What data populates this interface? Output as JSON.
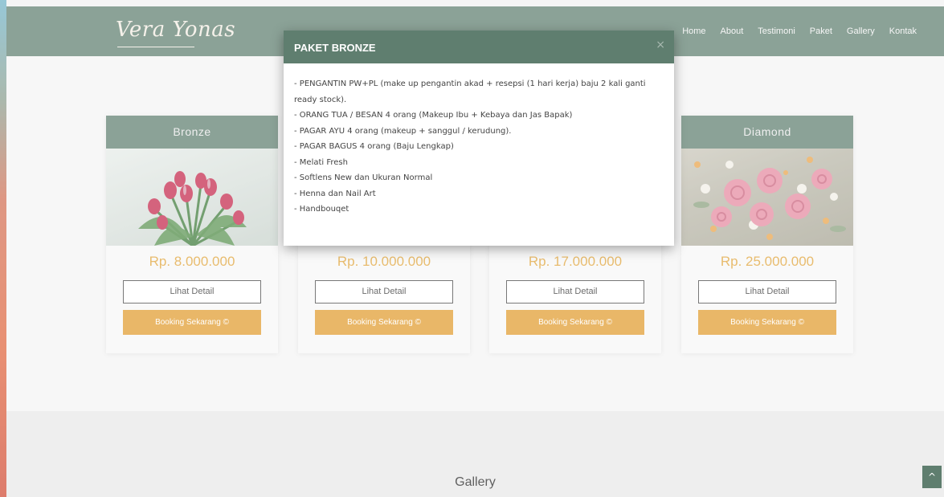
{
  "brand": "Vera Yonas",
  "nav": {
    "items": [
      "Home",
      "About",
      "Testimoni",
      "Paket",
      "Gallery",
      "Kontak"
    ],
    "active_index": 3
  },
  "cards": [
    {
      "title": "Bronze",
      "price": "Rp. 8.000.000",
      "detail_label": "Lihat Detail",
      "booking_label": "Booking Sekarang ©"
    },
    {
      "title": "",
      "price": "Rp. 10.000.000",
      "detail_label": "Lihat Detail",
      "booking_label": "Booking Sekarang ©"
    },
    {
      "title": "",
      "price": "Rp. 17.000.000",
      "detail_label": "Lihat Detail",
      "booking_label": "Booking Sekarang ©"
    },
    {
      "title": "Diamond",
      "price": "Rp. 25.000.000",
      "detail_label": "Lihat Detail",
      "booking_label": "Booking Sekarang ©"
    }
  ],
  "gallery": {
    "title": "Gallery"
  },
  "modal": {
    "title": "PAKET BRONZE",
    "close_icon": "×",
    "lines": [
      "- PENGANTIN PW+PL (make up pengantin akad + resepsi (1 hari kerja) baju 2 kali ganti",
      "ready stock).",
      "- ORANG TUA / BESAN 4 orang (Makeup Ibu + Kebaya dan Jas Bapak)",
      "- PAGAR AYU 4 orang (makeup + sanggul / kerudung).",
      "- PAGAR BAGUS 4 orang (Baju Lengkap)",
      "- Melati Fresh",
      "- Softlens New dan Ukuran Normal",
      "- Henna dan Nail Art",
      "- Handbouqet"
    ]
  },
  "scroll_top_icon": "^",
  "colors": {
    "primary": "#5f7e6f",
    "accent": "#e19c2e",
    "price": "#e0a236"
  }
}
